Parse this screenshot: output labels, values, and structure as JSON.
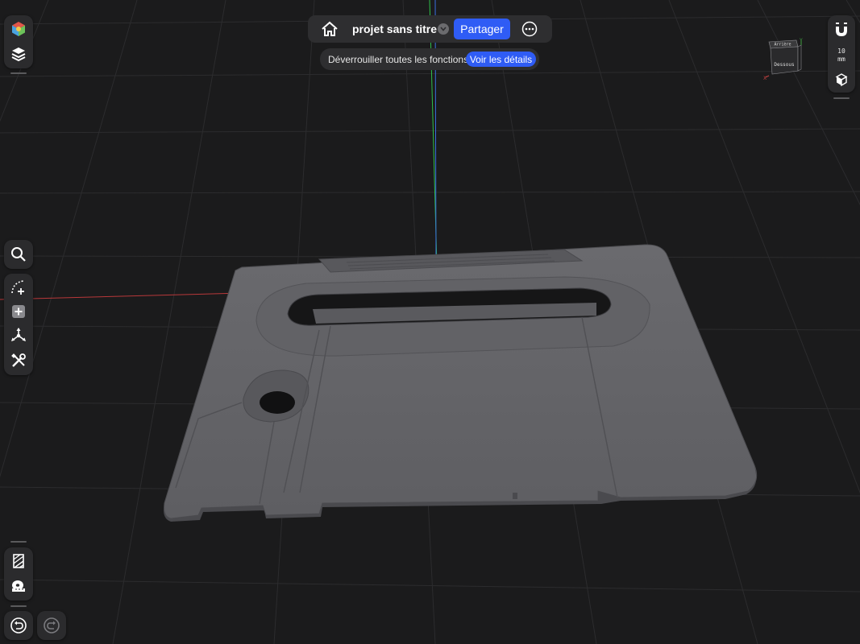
{
  "header": {
    "project_name": "projet sans titre",
    "share_label": "Partager"
  },
  "banner": {
    "text": "Déverrouiller toutes les fonctions",
    "details_label": "Voir les détails"
  },
  "view_cube": {
    "top_face_label": "Arrière",
    "front_face_label": "Dessous",
    "axis_x": "X",
    "axis_y": "Y"
  },
  "right_toolbar": {
    "snap_value": "10",
    "snap_unit": "mm"
  },
  "icons": {
    "top_left": [
      "color-cube-icon",
      "layers-icon"
    ],
    "tools": [
      "search-icon",
      "sketch-curve-icon",
      "add-primitive-icon",
      "transform-icon",
      "tools-icon"
    ],
    "bottom": [
      "section-view-icon",
      "measure-tape-icon",
      "undo-icon",
      "redo-icon"
    ],
    "right": [
      "magnet-snap-icon",
      "view-mode-icon"
    ]
  },
  "colors": {
    "accent": "#2f5cf5",
    "background": "#1b1b1c",
    "panel": "#2b2b2d",
    "model": "#6e6e72"
  }
}
